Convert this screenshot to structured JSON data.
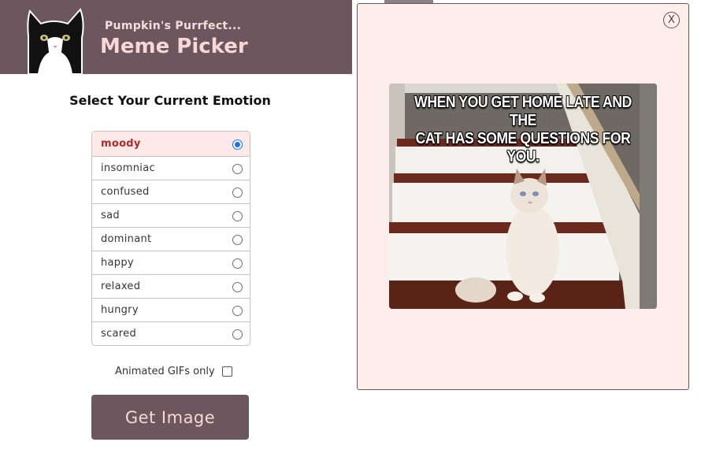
{
  "header": {
    "subtitle": "Pumpkin's Purrfect...",
    "title": "Meme Picker"
  },
  "emotions": {
    "heading": "Select Your Current Emotion",
    "items": [
      {
        "label": "moody",
        "selected": true
      },
      {
        "label": "insomniac",
        "selected": false
      },
      {
        "label": "confused",
        "selected": false
      },
      {
        "label": "sad",
        "selected": false
      },
      {
        "label": "dominant",
        "selected": false
      },
      {
        "label": "happy",
        "selected": false
      },
      {
        "label": "relaxed",
        "selected": false
      },
      {
        "label": "hungry",
        "selected": false
      },
      {
        "label": "scared",
        "selected": false
      }
    ]
  },
  "gif_filter": {
    "label": "Animated GIFs only",
    "checked": false
  },
  "get_button": {
    "label": "Get Image"
  },
  "modal": {
    "close_label": "X",
    "meme_caption_line1": "WHEN YOU GET HOME LATE AND THE",
    "meme_caption_line2": "CAT HAS SOME QUESTIONS FOR YOU."
  },
  "colors": {
    "brand": "#6b575d",
    "brand_text": "#f8d7d5",
    "selected_bg": "#fde9e8",
    "selected_text": "#b02a2a",
    "modal_bg": "#fdeeec"
  }
}
